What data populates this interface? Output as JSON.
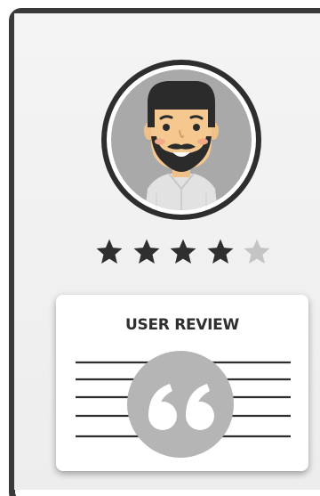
{
  "card": {
    "title": "USER REVIEW"
  },
  "rating": {
    "value": 4,
    "max": 5,
    "filled_color": "#2f2f2f",
    "empty_color": "#c4c4c4"
  },
  "icons": {
    "avatar": "bearded-man-avatar-icon",
    "star": "star-icon",
    "quote": "quote-mark-icon"
  },
  "colors": {
    "frame": "#3a3a3a",
    "screen_bg": "#f2f2f2",
    "avatar_ring": "#2e2e2e",
    "avatar_bg": "#a9a9a9",
    "quote_circle": "#b5b5b5",
    "lines": "#2e2e2e"
  }
}
